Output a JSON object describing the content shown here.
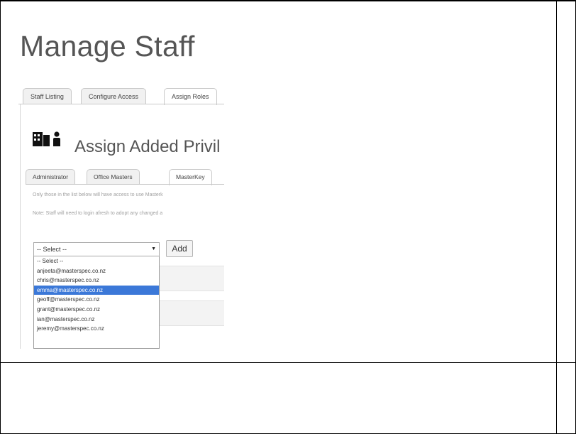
{
  "page": {
    "title": "Manage Staff"
  },
  "tabs": [
    {
      "label": "Staff Listing",
      "active": false
    },
    {
      "label": "Configure Access",
      "active": false
    },
    {
      "label": "Assign Roles",
      "active": true
    }
  ],
  "section": {
    "title": "Assign Added Privil",
    "icons": [
      "building-icon",
      "person-icon"
    ]
  },
  "subtabs": [
    {
      "label": "Administrator",
      "active": false
    },
    {
      "label": "Office Masters",
      "active": false
    },
    {
      "label": "MasterKey",
      "active": true
    }
  ],
  "notes": [
    "Only those in the list below will have access to use Masterk",
    "Note: Staff will need to login afresh to adopt any changed a"
  ],
  "select": {
    "value": "-- Select --",
    "options": [
      "-- Select --",
      "anjeeta@masterspec.co.nz",
      "chris@masterspec.co.nz",
      "emma@masterspec.co.nz",
      "geoff@masterspec.co.nz",
      "grant@masterspec.co.nz",
      "ian@masterspec.co.nz",
      "jeremy@masterspec.co.nz"
    ],
    "highlighted": "emma@masterspec.co.nz"
  },
  "add_button": {
    "label": "Add"
  },
  "colors": {
    "highlight": "#3b78d8",
    "title": "#555555"
  }
}
